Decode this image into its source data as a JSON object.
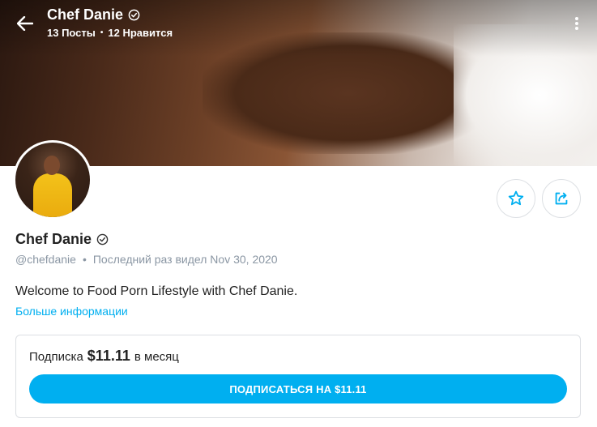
{
  "header": {
    "name": "Chef Danie",
    "posts": "13 Посты",
    "likes": "12 Нравится",
    "separator": "•"
  },
  "profile": {
    "name": "Chef Danie",
    "handle": "@chefdanie",
    "separator": "•",
    "last_seen": "Последний раз видел Nov 30, 2020",
    "bio": "Welcome to Food Porn Lifestyle with Chef Danie.",
    "more_info": "Больше информации"
  },
  "subscription": {
    "label": "Подписка",
    "price": "$11.11",
    "period": "в месяц",
    "button": "ПОДПИСАТЬСЯ НА $11.11"
  },
  "colors": {
    "accent": "#00aff0",
    "muted_text": "#8a96a3",
    "border": "#dcdfe3"
  },
  "icons": [
    "back-arrow-icon",
    "verified-icon",
    "more-vertical-icon",
    "star-icon",
    "share-icon"
  ]
}
